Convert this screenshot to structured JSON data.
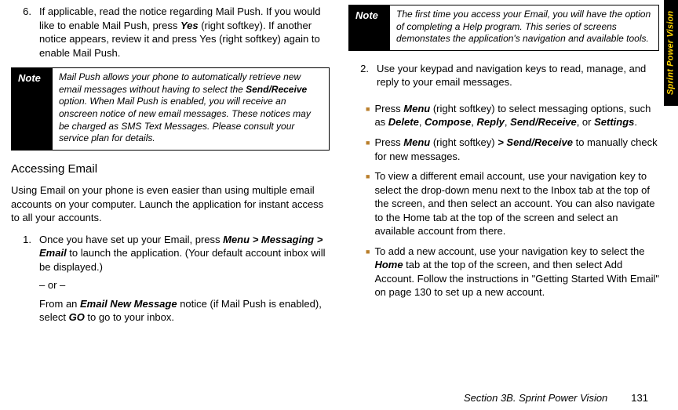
{
  "sidebarTab": "Sprint Power Vision",
  "leftCol": {
    "step6": {
      "num": "6.",
      "body_p1": "If applicable, read the notice regarding Mail Push. If you would like to enable Mail Push, press ",
      "body_yes": "Yes",
      "body_p2": " (right softkey). If another notice appears, review it and press Yes (right softkey) again to enable Mail Push."
    },
    "note1": {
      "label": "Note",
      "text_p1": "Mail Push allows your phone to automatically retrieve new email messages without having to select the ",
      "sendreceive": "Send/Receive",
      "text_p2": " option. When Mail Push is enabled, you will receive an onscreen notice of new email messages. These notices may be charged as SMS Text Messages. Please consult your service plan for details."
    },
    "heading": "Accessing Email",
    "intro": "Using Email on your phone is even easier than using multiple email accounts on your computer. Launch the application for instant access to all your accounts.",
    "step1": {
      "num": "1.",
      "p1": "Once you have set up your Email, press ",
      "menu": "Menu",
      "gt1": " > ",
      "messaging": "Messaging",
      "gt2": " > ",
      "email": "Email",
      "p2": " to launch the application. (Your default account inbox will be displayed.)",
      "or": "– or –",
      "alt_p1": "From an ",
      "alt_em": "Email New Message",
      "alt_p2": " notice (if Mail Push is enabled), select ",
      "go": "GO",
      "alt_p3": " to go to your inbox."
    }
  },
  "rightCol": {
    "note2": {
      "label": "Note",
      "text": "The first time you access your Email, you will have the option of completing a Help program. This series of screens demonstates the application's navigation and available tools."
    },
    "step2": {
      "num": "2.",
      "intro": "Use your keypad and navigation keys to read, manage, and reply to your email messages.",
      "bullets": [
        {
          "p1": "Press ",
          "menu": "Menu",
          "p2": " (right softkey) to select messaging options, such as ",
          "delete": "Delete",
          "c1": ", ",
          "compose": "Compose",
          "c2": ", ",
          "reply": "Reply",
          "c3": ", ",
          "sendrec": "Send/Receive",
          "c4": ", or ",
          "settings": "Settings",
          "end": "."
        },
        {
          "p1": "Press ",
          "menu": "Menu",
          "p2": " (right softkey) ",
          "gt": "> ",
          "sendrec": "Send/Receive",
          "p3": " to manually check for new messages."
        },
        {
          "text": "To view a different email account, use your navigation key to select the drop-down menu next to the Inbox tab at the top of the screen, and then select an account. You can also navigate to the Home tab at the top of the screen and select an available account from there."
        },
        {
          "p1": "To add a new account, use your navigation key to select the ",
          "home": "Home",
          "p2": " tab at the top of the screen, and then select Add Account. Follow the instructions in \"Getting Started With Email\" on page 130 to set up a new account."
        }
      ]
    }
  },
  "footer": {
    "section": "Section 3B. Sprint Power Vision",
    "page": "131"
  }
}
